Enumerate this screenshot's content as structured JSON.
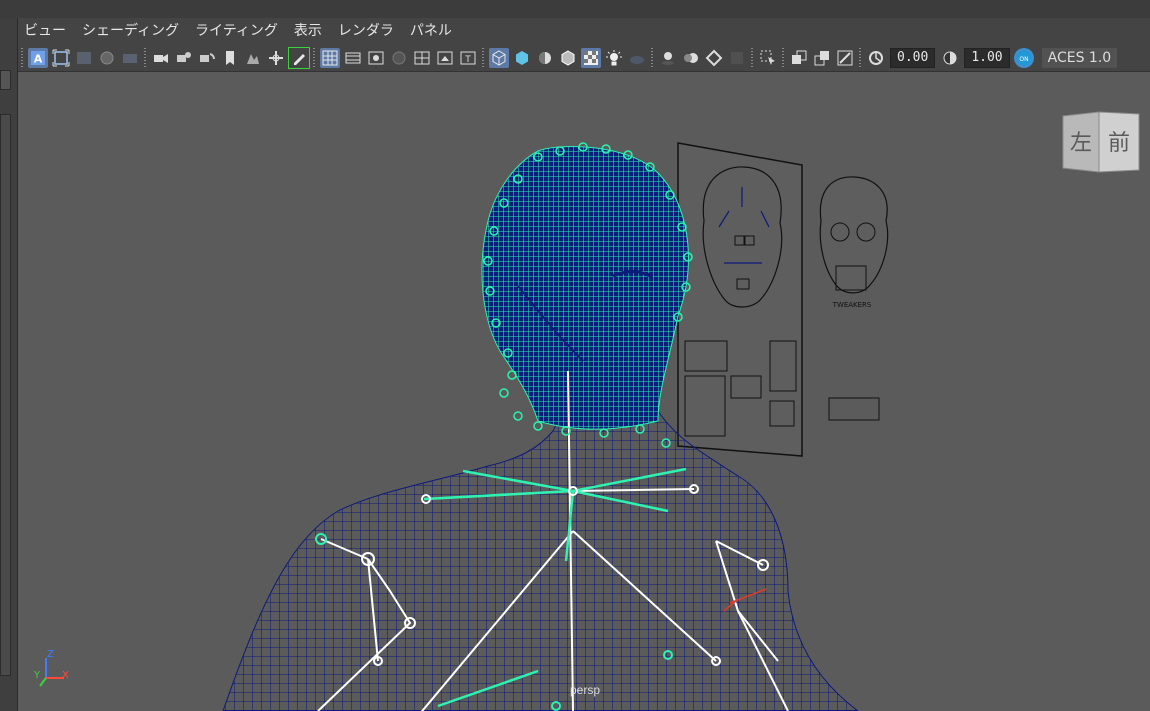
{
  "menubar": {
    "items": [
      "ビュー",
      "シェーディング",
      "ライティング",
      "表示",
      "レンダラ",
      "パネル"
    ]
  },
  "toolbar": {
    "exposure_value": "0.00",
    "gamma_value": "1.00",
    "color_space_label": "ACES 1.0"
  },
  "viewcube": {
    "left_label": "左",
    "front_label": "前"
  },
  "viewport": {
    "camera_label": "persp"
  },
  "axis_gizmo": {
    "z_label": "Z",
    "y_label": "Y",
    "x_label": "X"
  },
  "reference_sheet": {
    "tweakers_label": "TWEAKERS"
  },
  "colors": {
    "wireframe": "#0c1a7a",
    "selected_wireframe": "#2ef2b0",
    "joint": "#ffffff",
    "viewport_bg": "#5b5b5b",
    "accent": "#5d7aa6"
  }
}
